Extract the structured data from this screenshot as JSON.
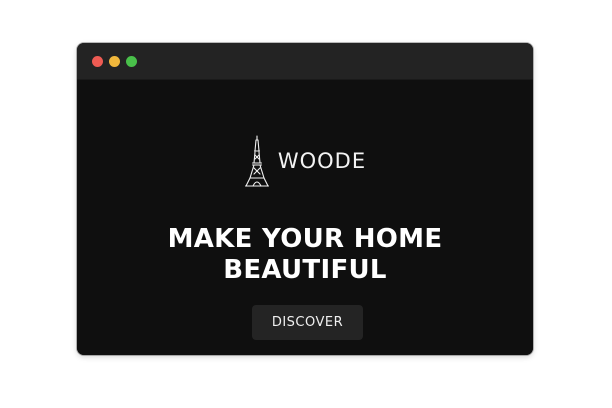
{
  "window": {
    "controls": [
      "close",
      "minimize",
      "maximize"
    ]
  },
  "brand": {
    "name": "WOODE",
    "logo_icon": "eiffel-tower-icon"
  },
  "hero": {
    "headline_line1": "MAKE YOUR HOME",
    "headline_line2": "BEAUTIFUL",
    "cta_label": "DISCOVER"
  },
  "colors": {
    "background": "#0f0f0f",
    "titlebar": "#232323",
    "button": "#242424",
    "text": "#ffffff",
    "close": "#ee5b53",
    "minimize": "#f0b73c",
    "maximize": "#49c04a"
  }
}
